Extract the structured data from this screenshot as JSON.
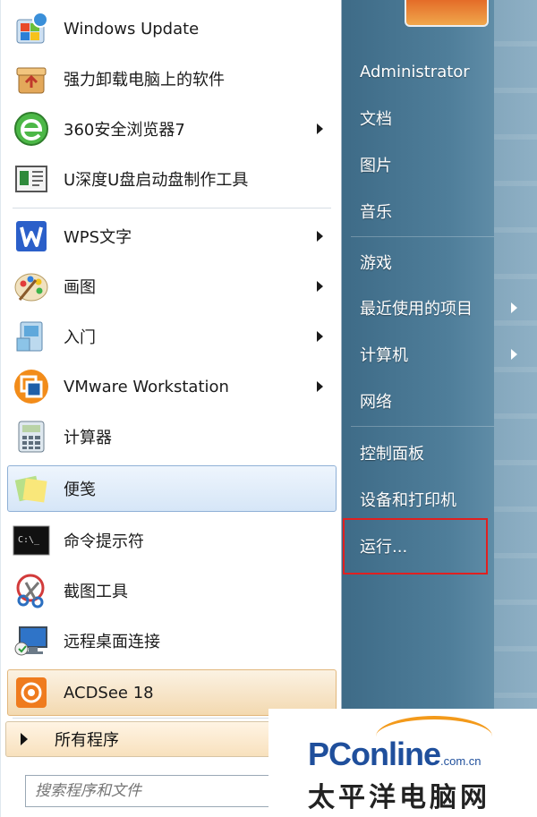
{
  "programs": [
    {
      "label": "Windows Update",
      "icon": "windows-update-icon",
      "arrow": false
    },
    {
      "label": "强力卸载电脑上的软件",
      "icon": "uninstall-box-icon",
      "arrow": false
    },
    {
      "label": "360安全浏览器7",
      "icon": "browser-360-icon",
      "arrow": true
    },
    {
      "label": "U深度U盘启动盘制作工具",
      "icon": "usb-boot-tool-icon",
      "arrow": false
    },
    {
      "label": "WPS文字",
      "icon": "wps-writer-icon",
      "arrow": true
    },
    {
      "label": "画图",
      "icon": "paint-palette-icon",
      "arrow": true
    },
    {
      "label": "入门",
      "icon": "getting-started-icon",
      "arrow": true
    },
    {
      "label": "VMware Workstation",
      "icon": "vmware-icon",
      "arrow": true
    },
    {
      "label": "计算器",
      "icon": "calculator-icon",
      "arrow": false
    },
    {
      "label": "便笺",
      "icon": "sticky-notes-icon",
      "arrow": false
    },
    {
      "label": "命令提示符",
      "icon": "command-prompt-icon",
      "arrow": false
    },
    {
      "label": "截图工具",
      "icon": "snipping-tool-icon",
      "arrow": false
    },
    {
      "label": "远程桌面连接",
      "icon": "remote-desktop-icon",
      "arrow": false
    },
    {
      "label": "ACDSee 18",
      "icon": "acdsee-icon",
      "arrow": false
    }
  ],
  "all_programs": "所有程序",
  "search_placeholder": "搜索程序和文件",
  "right": {
    "user": "Administrator",
    "items": [
      {
        "label": "文档",
        "arrow": false
      },
      {
        "label": "图片",
        "arrow": false
      },
      {
        "label": "音乐",
        "arrow": false
      },
      {
        "label": "游戏",
        "arrow": false
      },
      {
        "label": "最近使用的项目",
        "arrow": true
      },
      {
        "label": "计算机",
        "arrow": true
      },
      {
        "label": "网络",
        "arrow": false
      },
      {
        "label": "控制面板",
        "arrow": false
      },
      {
        "label": "设备和打印机",
        "arrow": false
      },
      {
        "label": "运行...",
        "arrow": false
      }
    ]
  },
  "watermark": {
    "brand": "PConline",
    "domain": ".com.cn",
    "chinese": "太平洋电脑网"
  },
  "colors": {
    "highlight_box": "#e02020",
    "right_pane": "#4f7e9a"
  }
}
